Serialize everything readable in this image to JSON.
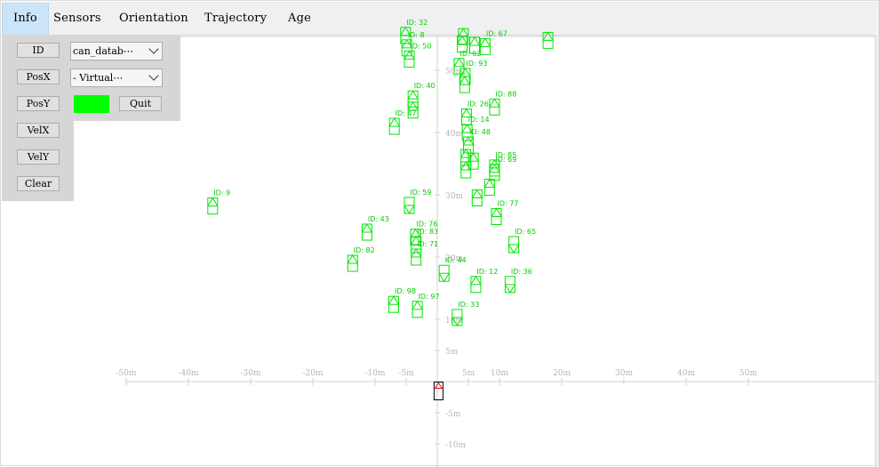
{
  "menu": {
    "items": [
      {
        "label": "Info",
        "active": true
      },
      {
        "label": "Sensors"
      },
      {
        "label": "Orientation"
      },
      {
        "label": "Trajectory"
      },
      {
        "label": "Age"
      }
    ]
  },
  "panel": {
    "buttons": [
      "ID",
      "PosX",
      "PosY",
      "VelX",
      "VelY",
      "Clear"
    ],
    "combo_database": "can_datab⋯",
    "combo_source": "- Virtual⋯",
    "quit_label": "Quit",
    "color": "#00ff00"
  },
  "axes": {
    "x_ticks": [
      "-50m",
      "-40m",
      "-30m",
      "-20m",
      "-10m",
      "-5m",
      "5m",
      "10m",
      "20m",
      "30m",
      "40m",
      "50m"
    ],
    "y_ticks": [
      "50m",
      "40m",
      "30m",
      "20m",
      "10m",
      "5m",
      "-5m",
      "-10m"
    ]
  },
  "objects": [
    {
      "id": "ID: 9",
      "x": -36.1,
      "y": 28.2,
      "up": true
    },
    {
      "id": "ID: 43",
      "x": -11.3,
      "y": 24.0,
      "up": true
    },
    {
      "id": "ID: 82",
      "x": -13.6,
      "y": 19.0,
      "up": true
    },
    {
      "id": "ID: 98",
      "x": -7.0,
      "y": 12.4,
      "up": true
    },
    {
      "id": "ID: 97",
      "x": -3.2,
      "y": 11.6,
      "up": true
    },
    {
      "id": "ID: 59",
      "x": -4.5,
      "y": 28.3,
      "up": false
    },
    {
      "id": "ID: 76",
      "x": -3.5,
      "y": 23.2,
      "up": true
    },
    {
      "id": "ID: 83",
      "x": -3.4,
      "y": 22.0,
      "up": true
    },
    {
      "id": "ID: 71",
      "x": -3.4,
      "y": 20.0,
      "up": true
    },
    {
      "id": "ID: 44",
      "x": 1.1,
      "y": 17.4,
      "up": false
    },
    {
      "id": "ID: 33",
      "x": 3.2,
      "y": 10.3,
      "up": false
    },
    {
      "id": "ID: 12",
      "x": 6.2,
      "y": 15.6,
      "up": true
    },
    {
      "id": "ID: 36",
      "x": 11.7,
      "y": 15.6,
      "up": false
    },
    {
      "id": "ID: 77",
      "x": 9.5,
      "y": 26.5,
      "up": true
    },
    {
      "id": "ID: 65",
      "x": 12.3,
      "y": 22.0,
      "up": false
    },
    {
      "id": "ID: 69",
      "x": 9.2,
      "y": 33.6,
      "up": true
    },
    {
      "id": "ID: 85",
      "x": 9.2,
      "y": 34.3,
      "up": true
    },
    {
      "id": "ID: 47",
      "x": -6.9,
      "y": 41.0,
      "up": true
    },
    {
      "id": "ID: 40",
      "x": -3.9,
      "y": 45.4,
      "up": true
    },
    {
      "id": "ID: 50",
      "x": -4.5,
      "y": 51.8,
      "up": true
    },
    {
      "id": "ID: 8",
      "x": -4.9,
      "y": 53.6,
      "up": true
    },
    {
      "id": "ID: 32",
      "x": -5.1,
      "y": 55.6,
      "up": true
    },
    {
      "id": "ID: 88",
      "x": 9.2,
      "y": 44.1,
      "up": true
    },
    {
      "id": "ID: 26",
      "x": 4.7,
      "y": 42.5,
      "up": true
    },
    {
      "id": "ID: 14",
      "x": 4.8,
      "y": 40.0,
      "up": true
    },
    {
      "id": "ID: 48",
      "x": 5.0,
      "y": 38.0,
      "up": true
    },
    {
      "id": "ID: 67",
      "x": 7.7,
      "y": 53.8,
      "up": true
    },
    {
      "id": "ID: 62",
      "x": 3.5,
      "y": 50.6,
      "up": true
    },
    {
      "id": "ID: 93",
      "x": 4.5,
      "y": 49.0,
      "up": true
    },
    {
      "id": "",
      "x": 4.6,
      "y": 36.0,
      "up": true
    },
    {
      "id": "",
      "x": 4.6,
      "y": 34.0,
      "up": true
    },
    {
      "id": "",
      "x": 5.8,
      "y": 35.4,
      "up": true
    },
    {
      "id": "",
      "x": 6.4,
      "y": 29.5,
      "up": true
    },
    {
      "id": "",
      "x": 8.4,
      "y": 31.2,
      "up": true
    },
    {
      "id": "",
      "x": 4.0,
      "y": 54.2,
      "up": true
    },
    {
      "id": "",
      "x": 4.2,
      "y": 55.4,
      "up": true
    },
    {
      "id": "",
      "x": 6.0,
      "y": 54.0,
      "up": true
    },
    {
      "id": "",
      "x": 17.8,
      "y": 54.8,
      "up": true
    },
    {
      "id": "",
      "x": -3.9,
      "y": 43.6,
      "up": true
    },
    {
      "id": "",
      "x": 4.4,
      "y": 47.7,
      "up": true
    }
  ],
  "ego": {
    "x": 0.2,
    "y": -1.5
  }
}
